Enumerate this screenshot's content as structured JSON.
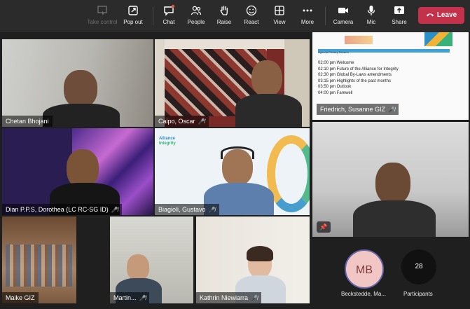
{
  "toolbar": {
    "take_control": "Take control",
    "pop_out": "Pop out",
    "chat": "Chat",
    "people": "People",
    "raise": "Raise",
    "react": "React",
    "view": "View",
    "more": "More",
    "camera": "Camera",
    "mic": "Mic",
    "share": "Share",
    "leave": "Leave"
  },
  "tiles": {
    "chetan": "Chetan Bhojani",
    "caipo": "Caipo, Oscar",
    "friedrich": "Friedrich, Susanne GIZ",
    "dian": "Dian P.P.S, Dorothea (LC RC-SG ID)",
    "biagioli": "Biagioli, Gustavo",
    "maike": "Maike GIZ",
    "martin": "Martin...",
    "kathrin": "Kathrin Niewiarra"
  },
  "agenda": {
    "title": "Agenda Plenary Session",
    "items": [
      "02:00 pm Welcome",
      "02:10 pm Future of the Alliance for Integrity",
      "02:30 pm Global By-Laws amendments",
      "03:15 pm Highlights of the past months",
      "03:50 pm Outlook",
      "04:00 pm Farewell"
    ]
  },
  "alliance_logo": {
    "line1": "Alliance",
    "line2": "Integrity"
  },
  "roster": {
    "avatar_initials": "MB",
    "avatar_name": "Beckstedde, Ma...",
    "participant_count": "28",
    "participants_label": "Participants"
  },
  "colors": {
    "leave": "#c4314b",
    "accent": "#6264a7"
  }
}
